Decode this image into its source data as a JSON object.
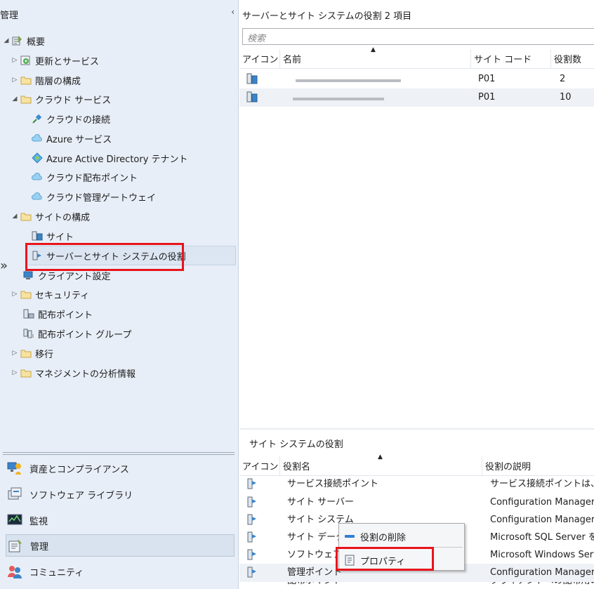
{
  "nav": {
    "title": "管理",
    "collapse_glyph": "‹",
    "expand_glyph": "»",
    "tree": [
      {
        "id": "overview",
        "label": "概要",
        "toggle": "◢"
      },
      {
        "id": "updates",
        "label": "更新とサービス",
        "toggle": "▷"
      },
      {
        "id": "hierarchy",
        "label": "階層の構成",
        "toggle": "▷"
      },
      {
        "id": "cloud-services",
        "label": "クラウド サービス",
        "toggle": "◢"
      },
      {
        "id": "cloud-attach",
        "label": "クラウドの接続"
      },
      {
        "id": "azure-services",
        "label": "Azure サービス"
      },
      {
        "id": "aad-tenant",
        "label": "Azure Active Directory テナント"
      },
      {
        "id": "cloud-dp",
        "label": "クラウド配布ポイント"
      },
      {
        "id": "cmg",
        "label": "クラウド管理ゲートウェイ"
      },
      {
        "id": "site-config",
        "label": "サイトの構成",
        "toggle": "◢"
      },
      {
        "id": "sites",
        "label": "サイト"
      },
      {
        "id": "server-roles",
        "label": "サーバーとサイト システムの役割"
      },
      {
        "id": "client-settings",
        "label": "クライアント設定"
      },
      {
        "id": "security",
        "label": "セキュリティ",
        "toggle": "▷"
      },
      {
        "id": "dp",
        "label": "配布ポイント"
      },
      {
        "id": "dp-groups",
        "label": "配布ポイント グループ"
      },
      {
        "id": "migration",
        "label": "移行",
        "toggle": "▷"
      },
      {
        "id": "insights",
        "label": "マネジメントの分析情報",
        "toggle": "▷"
      }
    ],
    "workspaces": [
      {
        "id": "assets",
        "label": "資産とコンプライアンス"
      },
      {
        "id": "software-library",
        "label": "ソフトウェア ライブラリ"
      },
      {
        "id": "monitoring",
        "label": "監視"
      },
      {
        "id": "administration",
        "label": "管理"
      },
      {
        "id": "community",
        "label": "コミュニティ"
      }
    ]
  },
  "content": {
    "title": "サーバーとサイト システムの役割 2 項目",
    "search_placeholder": "検索",
    "grid": {
      "columns": [
        "アイコン",
        "名前",
        "サイト コード",
        "役割数"
      ],
      "rows": [
        {
          "name": "",
          "site_code": "P01",
          "role_count": "2"
        },
        {
          "name": "",
          "site_code": "P01",
          "role_count": "10"
        }
      ]
    },
    "roles": {
      "title": "サイト システムの役割",
      "columns": [
        "アイコン",
        "役割名",
        "役割の説明"
      ],
      "rows": [
        {
          "name": "サービス接続ポイント",
          "desc": "サービス接続ポイントは、Co"
        },
        {
          "name": "サイト サーバー",
          "desc": "Configuration Manager"
        },
        {
          "name": "サイト システム",
          "desc": "Configuration Manager"
        },
        {
          "name": "サイト データベ",
          "desc": "Microsoft SQL Server を実"
        },
        {
          "name": "ソフトウェアの",
          "desc": "Microsoft Windows Serv"
        },
        {
          "name": "管理ポイント",
          "desc": "Configuration Manager"
        },
        {
          "name": "配布ポイント",
          "desc": "クライアントへの配布用のパ"
        }
      ]
    },
    "context_menu": {
      "items": [
        {
          "id": "remove-role",
          "label": "役割の削除"
        },
        {
          "id": "properties",
          "label": "プロパティ"
        }
      ]
    }
  }
}
